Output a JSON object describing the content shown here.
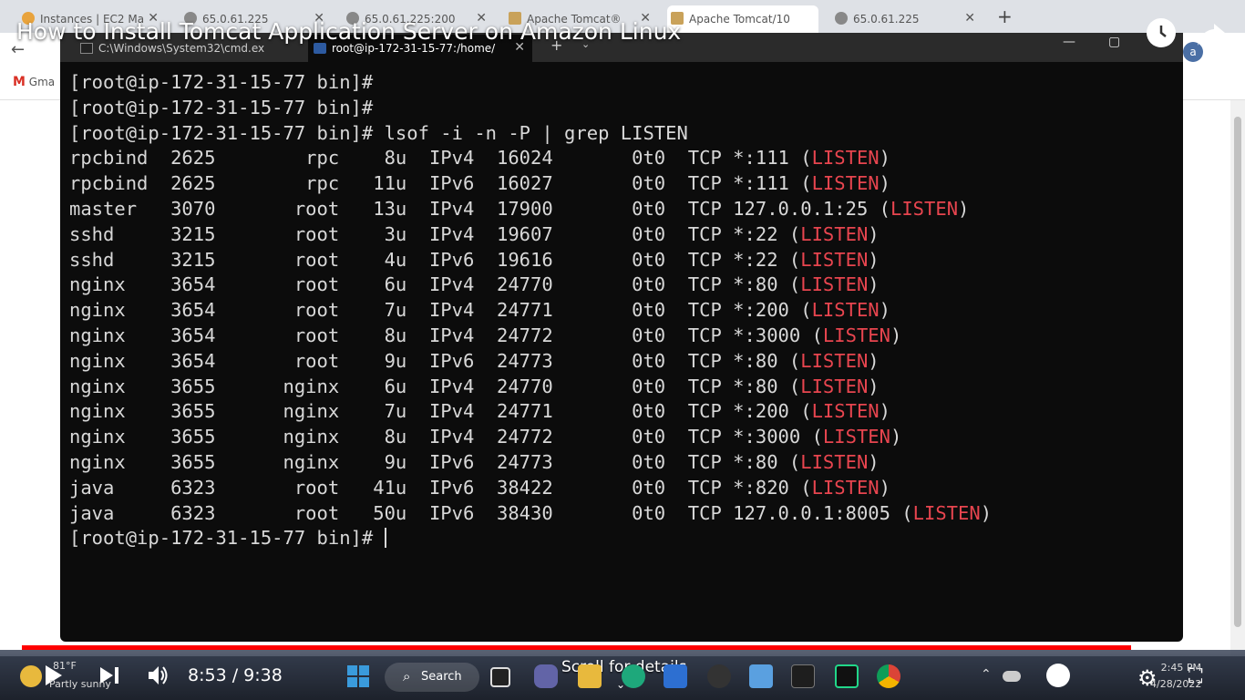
{
  "browser": {
    "tabs": [
      {
        "label": "Instances | EC2 Ma"
      },
      {
        "label": "65.0.61.225"
      },
      {
        "label": "65.0.61.225:200"
      },
      {
        "label": "Apache Tomcat®"
      },
      {
        "label": "Apache Tomcat/10"
      },
      {
        "label": "65.0.61.225"
      }
    ],
    "new_tab": "+",
    "bookmark_gmail": "Gma",
    "avatar_letter": "a"
  },
  "terminal": {
    "tabs": [
      {
        "label": "C:\\Windows\\System32\\cmd.ex"
      },
      {
        "label": "root@ip-172-31-15-77:/home/"
      }
    ],
    "new_tab": "+",
    "dropdown": "⌄",
    "window_buttons": {
      "minimize": "—",
      "maximize": "▢",
      "close": "✕"
    },
    "listen_word": "LISTEN",
    "prompt_lines": [
      "[root@ip-172-31-15-77 bin]#",
      "[root@ip-172-31-15-77 bin]#",
      "[root@ip-172-31-15-77 bin]# lsof -i -n -P | grep LISTEN"
    ],
    "rows": [
      {
        "cmd": "rpcbind",
        "pid": "2625",
        "user": "rpc",
        "fd": "8u",
        "type": "IPv4",
        "device": "16024",
        "size": "0t0",
        "node": "TCP",
        "name": "*:111"
      },
      {
        "cmd": "rpcbind",
        "pid": "2625",
        "user": "rpc",
        "fd": "11u",
        "type": "IPv6",
        "device": "16027",
        "size": "0t0",
        "node": "TCP",
        "name": "*:111"
      },
      {
        "cmd": "master",
        "pid": "3070",
        "user": "root",
        "fd": "13u",
        "type": "IPv4",
        "device": "17900",
        "size": "0t0",
        "node": "TCP",
        "name": "127.0.0.1:25"
      },
      {
        "cmd": "sshd",
        "pid": "3215",
        "user": "root",
        "fd": "3u",
        "type": "IPv4",
        "device": "19607",
        "size": "0t0",
        "node": "TCP",
        "name": "*:22"
      },
      {
        "cmd": "sshd",
        "pid": "3215",
        "user": "root",
        "fd": "4u",
        "type": "IPv6",
        "device": "19616",
        "size": "0t0",
        "node": "TCP",
        "name": "*:22"
      },
      {
        "cmd": "nginx",
        "pid": "3654",
        "user": "root",
        "fd": "6u",
        "type": "IPv4",
        "device": "24770",
        "size": "0t0",
        "node": "TCP",
        "name": "*:80"
      },
      {
        "cmd": "nginx",
        "pid": "3654",
        "user": "root",
        "fd": "7u",
        "type": "IPv4",
        "device": "24771",
        "size": "0t0",
        "node": "TCP",
        "name": "*:200"
      },
      {
        "cmd": "nginx",
        "pid": "3654",
        "user": "root",
        "fd": "8u",
        "type": "IPv4",
        "device": "24772",
        "size": "0t0",
        "node": "TCP",
        "name": "*:3000"
      },
      {
        "cmd": "nginx",
        "pid": "3654",
        "user": "root",
        "fd": "9u",
        "type": "IPv6",
        "device": "24773",
        "size": "0t0",
        "node": "TCP",
        "name": "*:80"
      },
      {
        "cmd": "nginx",
        "pid": "3655",
        "user": "nginx",
        "fd": "6u",
        "type": "IPv4",
        "device": "24770",
        "size": "0t0",
        "node": "TCP",
        "name": "*:80"
      },
      {
        "cmd": "nginx",
        "pid": "3655",
        "user": "nginx",
        "fd": "7u",
        "type": "IPv4",
        "device": "24771",
        "size": "0t0",
        "node": "TCP",
        "name": "*:200"
      },
      {
        "cmd": "nginx",
        "pid": "3655",
        "user": "nginx",
        "fd": "8u",
        "type": "IPv4",
        "device": "24772",
        "size": "0t0",
        "node": "TCP",
        "name": "*:3000"
      },
      {
        "cmd": "nginx",
        "pid": "3655",
        "user": "nginx",
        "fd": "9u",
        "type": "IPv6",
        "device": "24773",
        "size": "0t0",
        "node": "TCP",
        "name": "*:80"
      },
      {
        "cmd": "java",
        "pid": "6323",
        "user": "root",
        "fd": "41u",
        "type": "IPv6",
        "device": "38422",
        "size": "0t0",
        "node": "TCP",
        "name": "*:820"
      },
      {
        "cmd": "java",
        "pid": "6323",
        "user": "root",
        "fd": "50u",
        "type": "IPv6",
        "device": "38430",
        "size": "0t0",
        "node": "TCP",
        "name": "127.0.0.1:8005"
      }
    ],
    "final_prompt": "[root@ip-172-31-15-77 bin]# "
  },
  "youtube": {
    "title": "How to Install Tomcat Application Server on Amazon Linux",
    "current_time": "8:53",
    "duration": "9:38",
    "time_display": "8:53 / 9:38",
    "scroll_hint": "Scroll for details",
    "progress": 0.923
  },
  "taskbar": {
    "weather_temp": "81°F",
    "weather_desc": "Partly sunny",
    "search_label": "Search",
    "clock_time": "2:45 PM",
    "clock_date": "4/28/2022"
  },
  "colors": {
    "terminal_bg": "#0c0c0c",
    "terminal_fg": "#d8d8d8",
    "listen_red": "#e8454f",
    "progress_red": "#ff0000"
  }
}
